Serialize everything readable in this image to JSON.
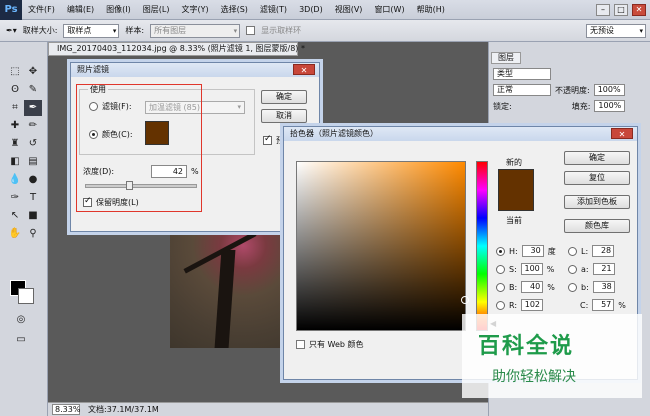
{
  "menubar": {
    "logo": "Ps",
    "items": [
      "文件(F)",
      "编辑(E)",
      "图像(I)",
      "图层(L)",
      "文字(Y)",
      "选择(S)",
      "滤镜(T)",
      "3D(D)",
      "视图(V)",
      "窗口(W)",
      "帮助(H)"
    ],
    "minimize": "–",
    "restore": "□",
    "close": "✕"
  },
  "options": {
    "sample_size_label": "取样大小:",
    "sample_size_value": "取样点",
    "sample_label": "样本:",
    "sample_value": "所有图层",
    "show_ring_label": "显示取样环",
    "workspace_value": "无预设"
  },
  "document": {
    "tab_title": "IMG_20170403_112034.jpg @ 8.33% (照片滤镜 1, 图层蒙版/8) *",
    "zoom": "8.33%",
    "status": "文档:37.1M/37.1M"
  },
  "panels": {
    "tab": "图层",
    "kind_label": "类型",
    "blend_mode": "正常",
    "opacity_label": "不透明度:",
    "opacity_value": "100%",
    "lock_label": "锁定:",
    "fill_label": "填充:",
    "fill_value": "100%"
  },
  "photo_filter": {
    "title": "照片滤镜",
    "use_label": "使用",
    "filter_option": "滤镜(F):",
    "filter_value": "加温滤镜 (85)",
    "color_option": "颜色(C):",
    "color_hex": "#643200",
    "density_label": "浓度(D):",
    "density_value": "42",
    "density_unit": "%",
    "preserve_label": "保留明度(L)",
    "ok": "确定",
    "cancel": "取消",
    "preview": "预"
  },
  "color_picker": {
    "title": "拾色器（照片滤镜颜色）",
    "new_label": "新的",
    "current_label": "当前",
    "ok": "确定",
    "reset": "复位",
    "add_swatch": "添加到色板",
    "color_library": "颜色库",
    "h_label": "H:",
    "h_value": "30",
    "h_unit": "度",
    "s_label": "S:",
    "s_value": "100",
    "s_unit": "%",
    "b_label": "B:",
    "b_value": "40",
    "b_unit": "%",
    "r_label": "R:",
    "r_value": "102",
    "l_label": "L:",
    "l_value": "28",
    "a_label": "a:",
    "a_value": "21",
    "b2_label": "b:",
    "b2_value": "38",
    "c_label": "C:",
    "c_value": "57",
    "c_unit": "%",
    "web_only_label": "只有 Web 颜色",
    "swatch_hex": "#643200"
  },
  "watermark": {
    "logo": "百科全说",
    "sub": "助你轻松解决"
  }
}
